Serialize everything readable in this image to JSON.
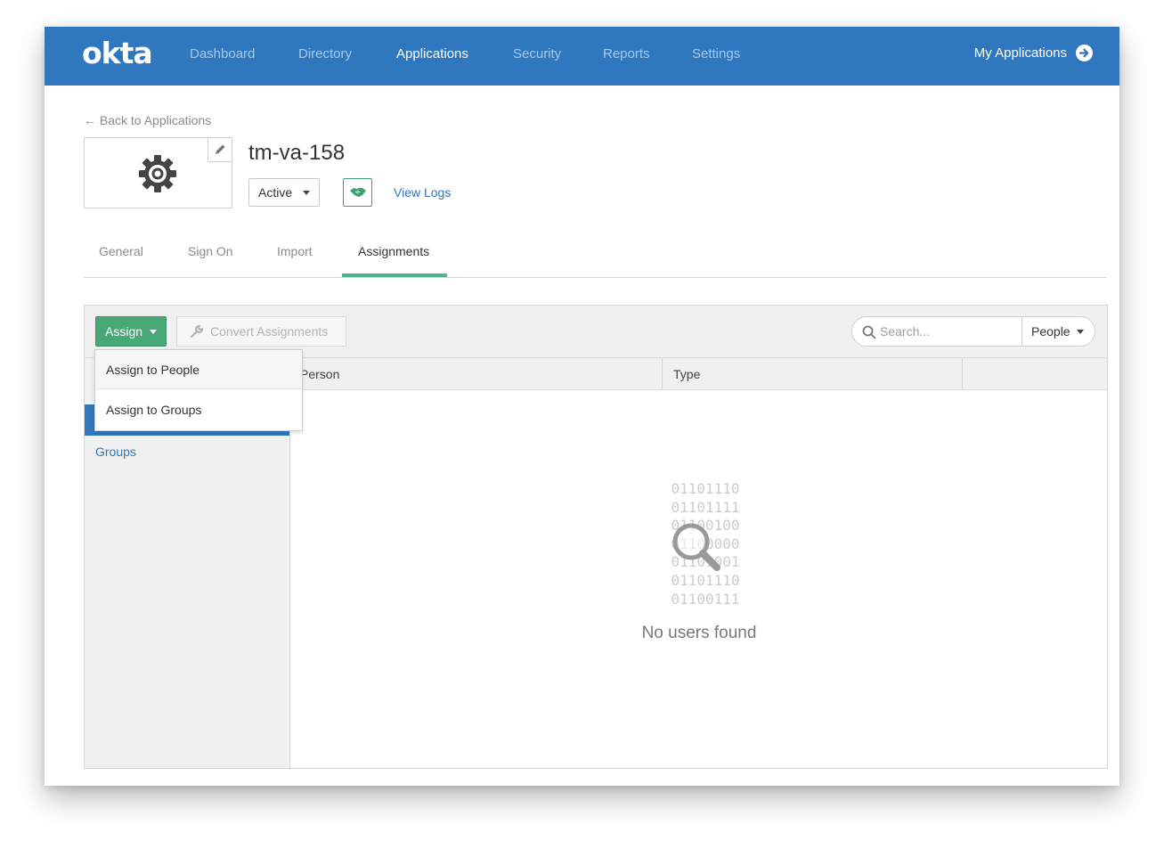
{
  "brand": {
    "logo_text": "okta",
    "nav_bg": "#2f77bf",
    "accent_green": "#48a876"
  },
  "nav": {
    "items": [
      {
        "label": "Dashboard"
      },
      {
        "label": "Directory"
      },
      {
        "label": "Applications"
      },
      {
        "label": "Security"
      },
      {
        "label": "Reports"
      },
      {
        "label": "Settings"
      }
    ],
    "active": "Applications",
    "my_apps_label": "My Applications",
    "my_apps_icon": "arrow-circle-right-icon"
  },
  "header": {
    "back_link": "← Back to Applications",
    "app_title": "tm-va-158",
    "app_icon": "gear-icon",
    "status_value": "Active",
    "view_logs": "View Logs"
  },
  "tabs": [
    {
      "label": "General"
    },
    {
      "label": "Sign On"
    },
    {
      "label": "Import"
    },
    {
      "label": "Assignments"
    }
  ],
  "active_tab": "Assignments",
  "toolbar": {
    "assign_label": "Assign",
    "convert_label": "Convert Assignments",
    "search_placeholder": "Search...",
    "filter_value": "People"
  },
  "dropdown": {
    "items": [
      {
        "label": "Assign to People"
      },
      {
        "label": "Assign to Groups"
      }
    ]
  },
  "sidebar": {
    "groups_label": "Groups"
  },
  "table": {
    "columns": [
      "Person",
      "Type"
    ]
  },
  "empty_state": {
    "binary_lines": [
      "01101110",
      "01101111",
      "01100100",
      "01100000",
      "01101001",
      "01101110",
      "01100111"
    ],
    "message": "No users found"
  }
}
